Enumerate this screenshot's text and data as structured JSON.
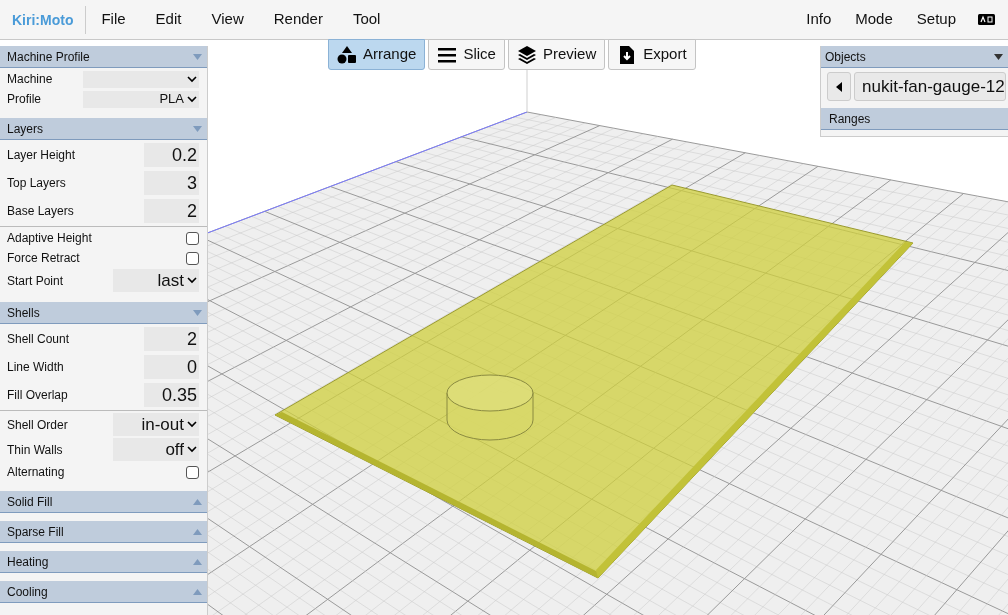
{
  "app": {
    "title": "Kiri:Moto"
  },
  "menu": {
    "left": [
      "File",
      "Edit",
      "View",
      "Render",
      "Tool"
    ],
    "right": [
      "Info",
      "Mode",
      "Setup"
    ]
  },
  "mode_buttons": [
    {
      "kind": "arrange",
      "label": "Arrange",
      "selected": true
    },
    {
      "kind": "slice",
      "label": "Slice",
      "selected": false
    },
    {
      "kind": "preview",
      "label": "Preview",
      "selected": false
    },
    {
      "kind": "export",
      "label": "Export",
      "selected": false
    }
  ],
  "sidebar": {
    "sections": [
      {
        "title": "Machine Profile",
        "expanded": true,
        "groups": [
          [
            {
              "kind": "select",
              "label": "Machine"
            },
            {
              "kind": "select",
              "label": "Profile",
              "value": "PLA"
            }
          ]
        ]
      },
      {
        "title": "Layers",
        "expanded": true,
        "groups": [
          [
            {
              "kind": "number",
              "label": "Layer Height",
              "value": "0.2"
            },
            {
              "kind": "number",
              "label": "Top Layers",
              "value": "3"
            },
            {
              "kind": "number",
              "label": "Base Layers",
              "value": "2"
            }
          ],
          [
            {
              "kind": "checkbox",
              "label": "Adaptive Height",
              "checked": false
            },
            {
              "kind": "checkbox",
              "label": "Force Retract",
              "checked": false
            },
            {
              "kind": "select",
              "label": "Start Point",
              "value": "last"
            }
          ]
        ]
      },
      {
        "title": "Shells",
        "expanded": true,
        "groups": [
          [
            {
              "kind": "number",
              "label": "Shell Count",
              "value": "2"
            },
            {
              "kind": "number",
              "label": "Line Width",
              "value": "0"
            },
            {
              "kind": "number",
              "label": "Fill Overlap",
              "value": "0.35"
            }
          ],
          [
            {
              "kind": "select",
              "label": "Shell Order",
              "value": "in-out"
            },
            {
              "kind": "select",
              "label": "Thin Walls",
              "value": "off"
            },
            {
              "kind": "checkbox",
              "label": "Alternating",
              "checked": false
            }
          ]
        ]
      },
      {
        "title": "Solid Fill",
        "expanded": false
      },
      {
        "title": "Sparse Fill",
        "expanded": false
      },
      {
        "title": "Heating",
        "expanded": false
      },
      {
        "title": "Cooling",
        "expanded": false
      }
    ]
  },
  "objects_panel": {
    "title": "Objects",
    "expanded": true,
    "items": [
      "nukit-fan-gauge-12"
    ]
  },
  "ranges_panel": {
    "title": "Ranges"
  }
}
